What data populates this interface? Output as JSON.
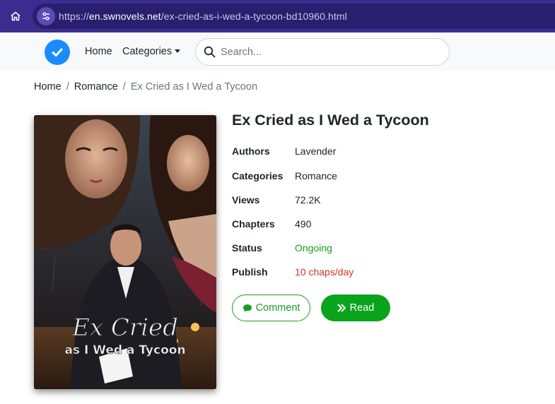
{
  "browser": {
    "url_prefix": "https://",
    "url_host": "en.swnovels.net",
    "url_path": "/ex-cried-as-i-wed-a-tycoon-bd10960.html",
    "home_icon": "home-icon",
    "site_settings_icon": "sliders-icon"
  },
  "nav": {
    "logo_icon": "check-circle-icon",
    "home_label": "Home",
    "categories_label": "Categories",
    "search_placeholder": "Search..."
  },
  "breadcrumb": {
    "items": [
      "Home",
      "Romance"
    ],
    "current": "Ex Cried as I Wed a Tycoon",
    "separator": "/"
  },
  "book": {
    "title": "Ex Cried as I Wed a Tycoon",
    "cover_text_line1": "Ex Cried",
    "cover_text_line2": "as I Wed a Tycoon",
    "details": [
      {
        "label": "Authors",
        "value": "Lavender",
        "tone": "default"
      },
      {
        "label": "Categories",
        "value": "Romance",
        "tone": "default"
      },
      {
        "label": "Views",
        "value": "72.2K",
        "tone": "default"
      },
      {
        "label": "Chapters",
        "value": "490",
        "tone": "default"
      },
      {
        "label": "Status",
        "value": "Ongoing",
        "tone": "green"
      },
      {
        "label": "Publish",
        "value": "10 chaps/day",
        "tone": "red"
      }
    ]
  },
  "actions": {
    "comment_label": "Comment",
    "comment_icon": "comment-icon",
    "read_label": "Read",
    "read_icon": "double-chevron-right-icon"
  },
  "colors": {
    "browser_bar": "#3b2d8f",
    "accent_green": "#0aa31c",
    "status_green": "#14a01e",
    "publish_red": "#d0342c",
    "logo_blue": "#1a8cff"
  }
}
